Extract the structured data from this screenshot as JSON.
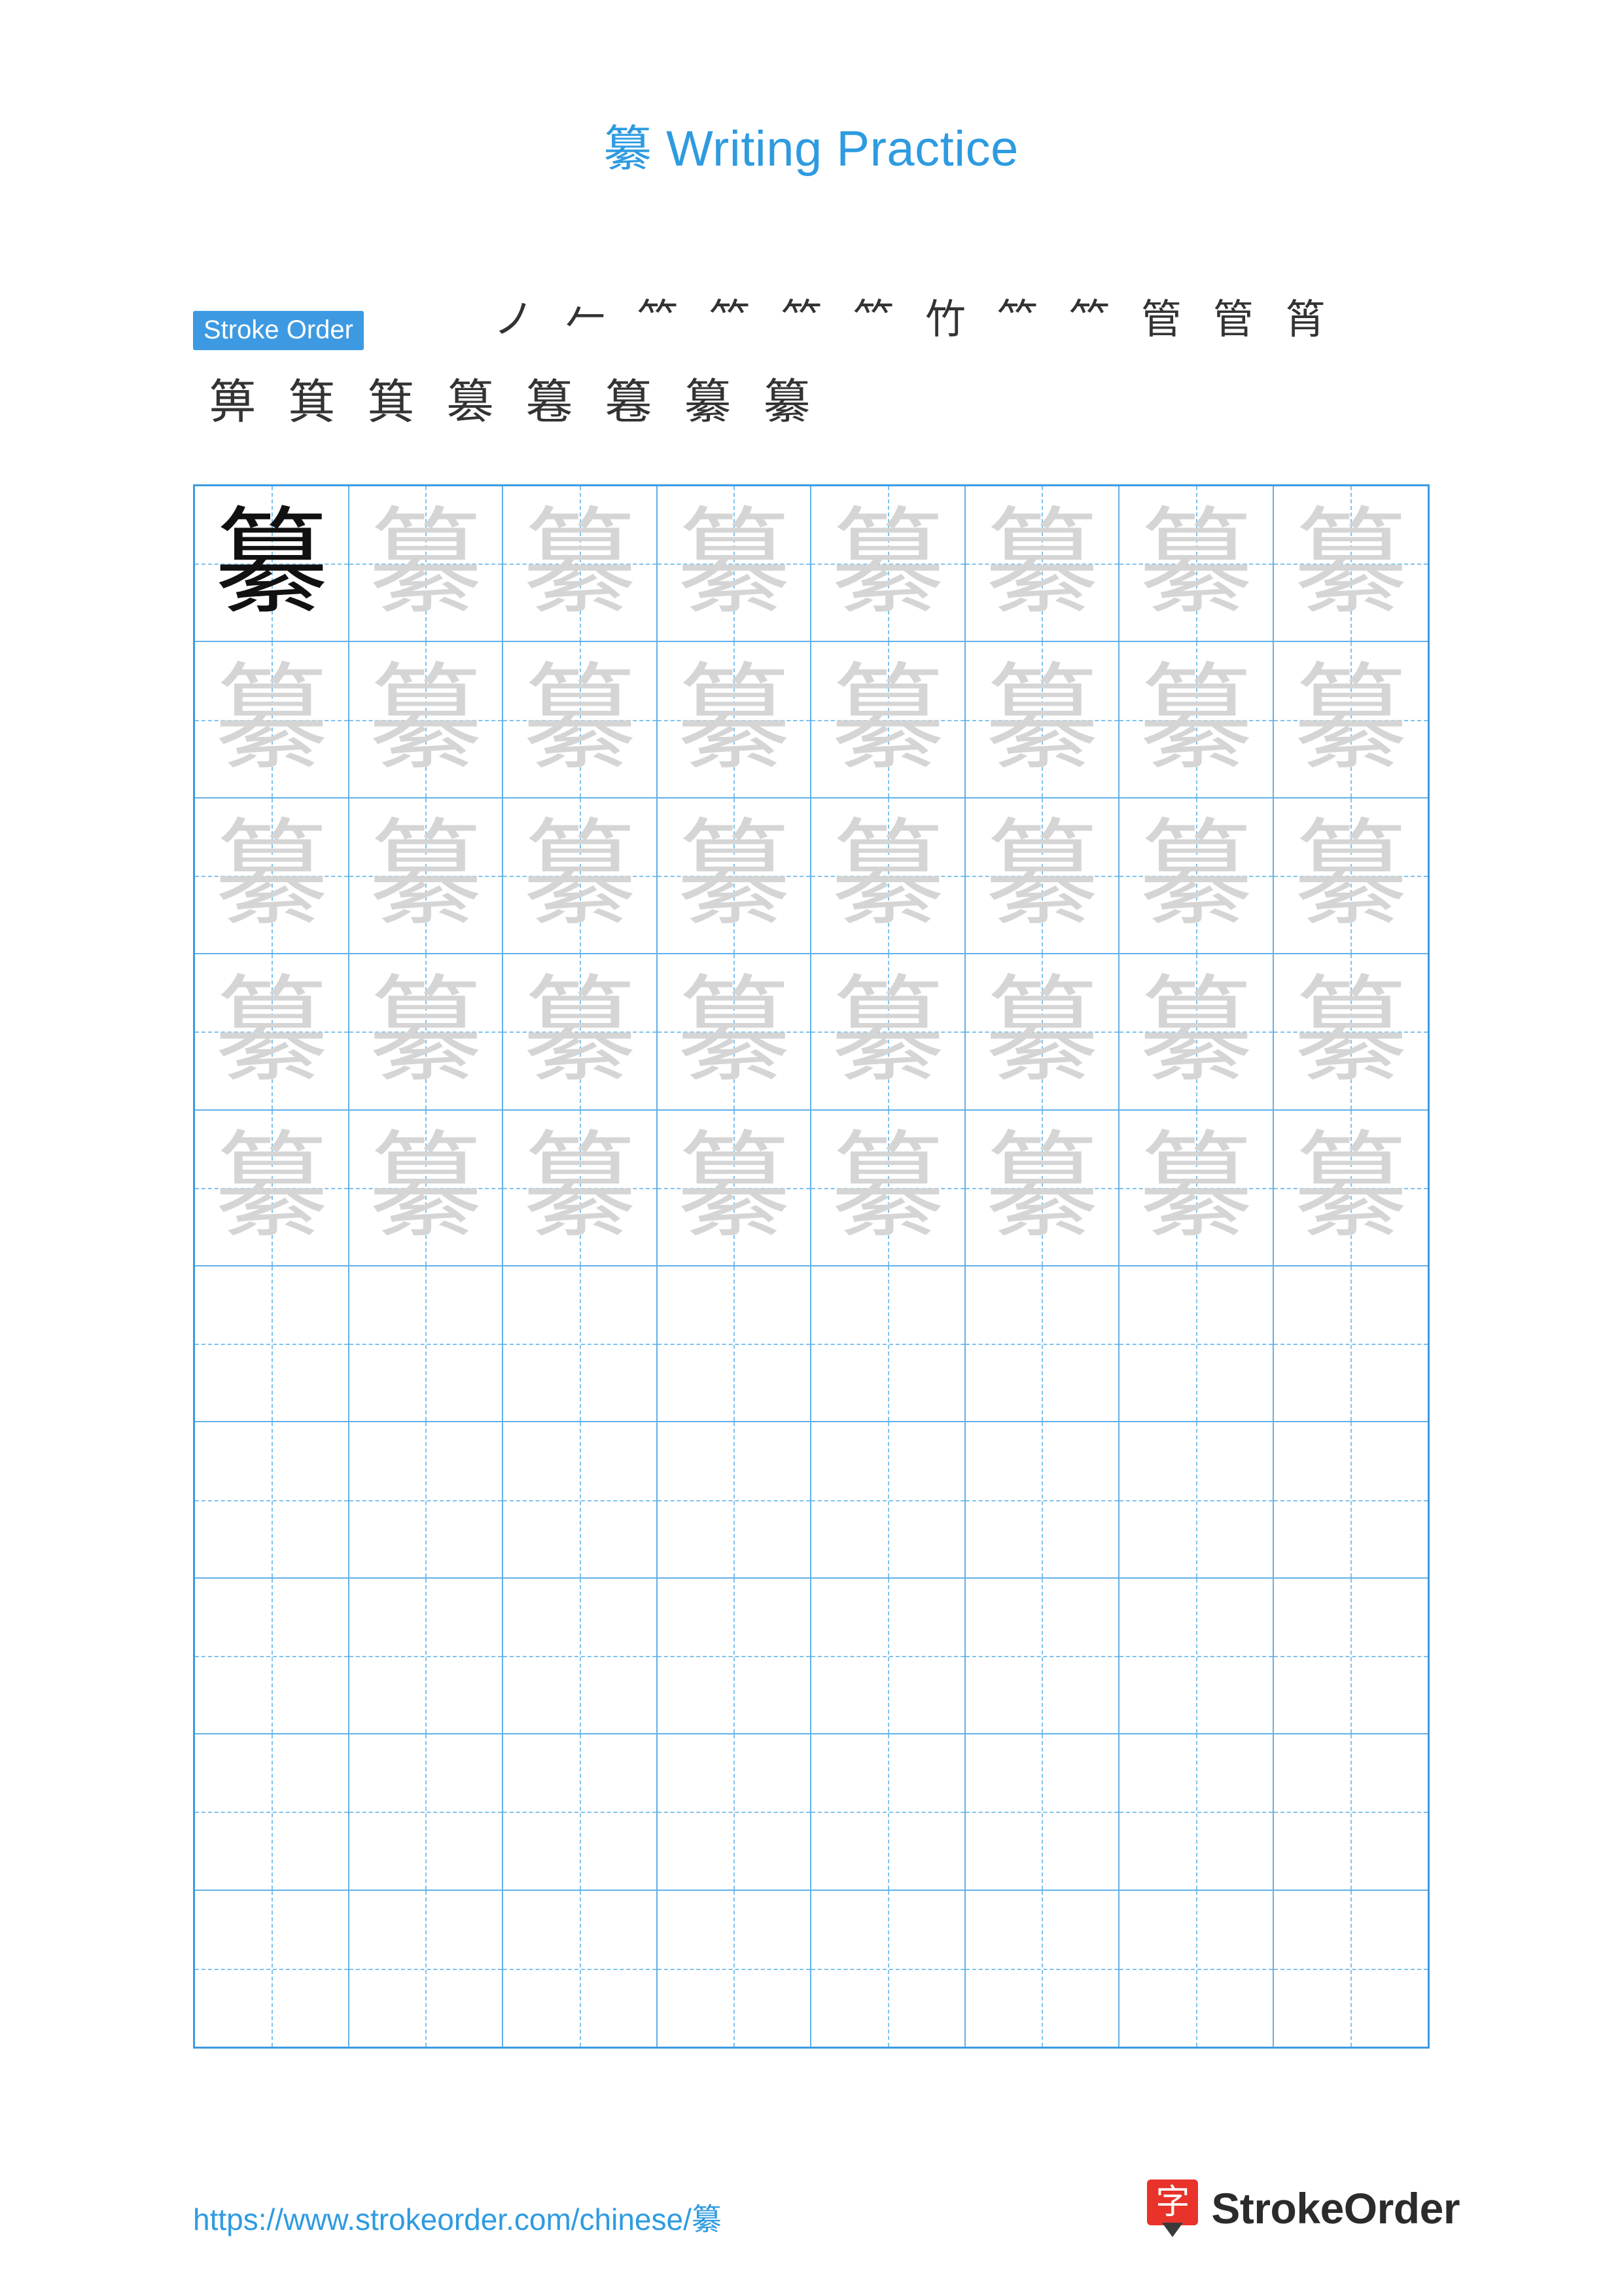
{
  "page": {
    "character": "纂",
    "title_suffix": " Writing Practice",
    "title_full": "纂 Writing Practice"
  },
  "stroke_order": {
    "label": "Stroke Order",
    "row1": [
      "ノ",
      "𠂉",
      "𥫗",
      "𥫗",
      "𥫗",
      "𥫗",
      "竹",
      "𥫗",
      "𥫗",
      "管",
      "管",
      "筲"
    ],
    "row2": [
      "箅",
      "箕",
      "箕",
      "篡",
      "篹",
      "篹",
      "纂",
      "纂"
    ],
    "total_strokes": 20
  },
  "practice_grid": {
    "columns": 8,
    "rows": 10,
    "model_cell": {
      "row": 1,
      "column": 1,
      "style": "solid",
      "char": "纂"
    },
    "traced_rows": 5,
    "blank_rows": 5,
    "grid_color": "#63b0e8",
    "guide_color": "#7fc2ee",
    "solid_color": "#111111",
    "faint_color": "#d5d5d5"
  },
  "footer": {
    "url": "https://www.strokeorder.com/chinese/纂",
    "brand": "StrokeOrder",
    "brand_logo_char": "字",
    "brand_accent": "#e8322a",
    "link_color": "#2e9be0"
  }
}
